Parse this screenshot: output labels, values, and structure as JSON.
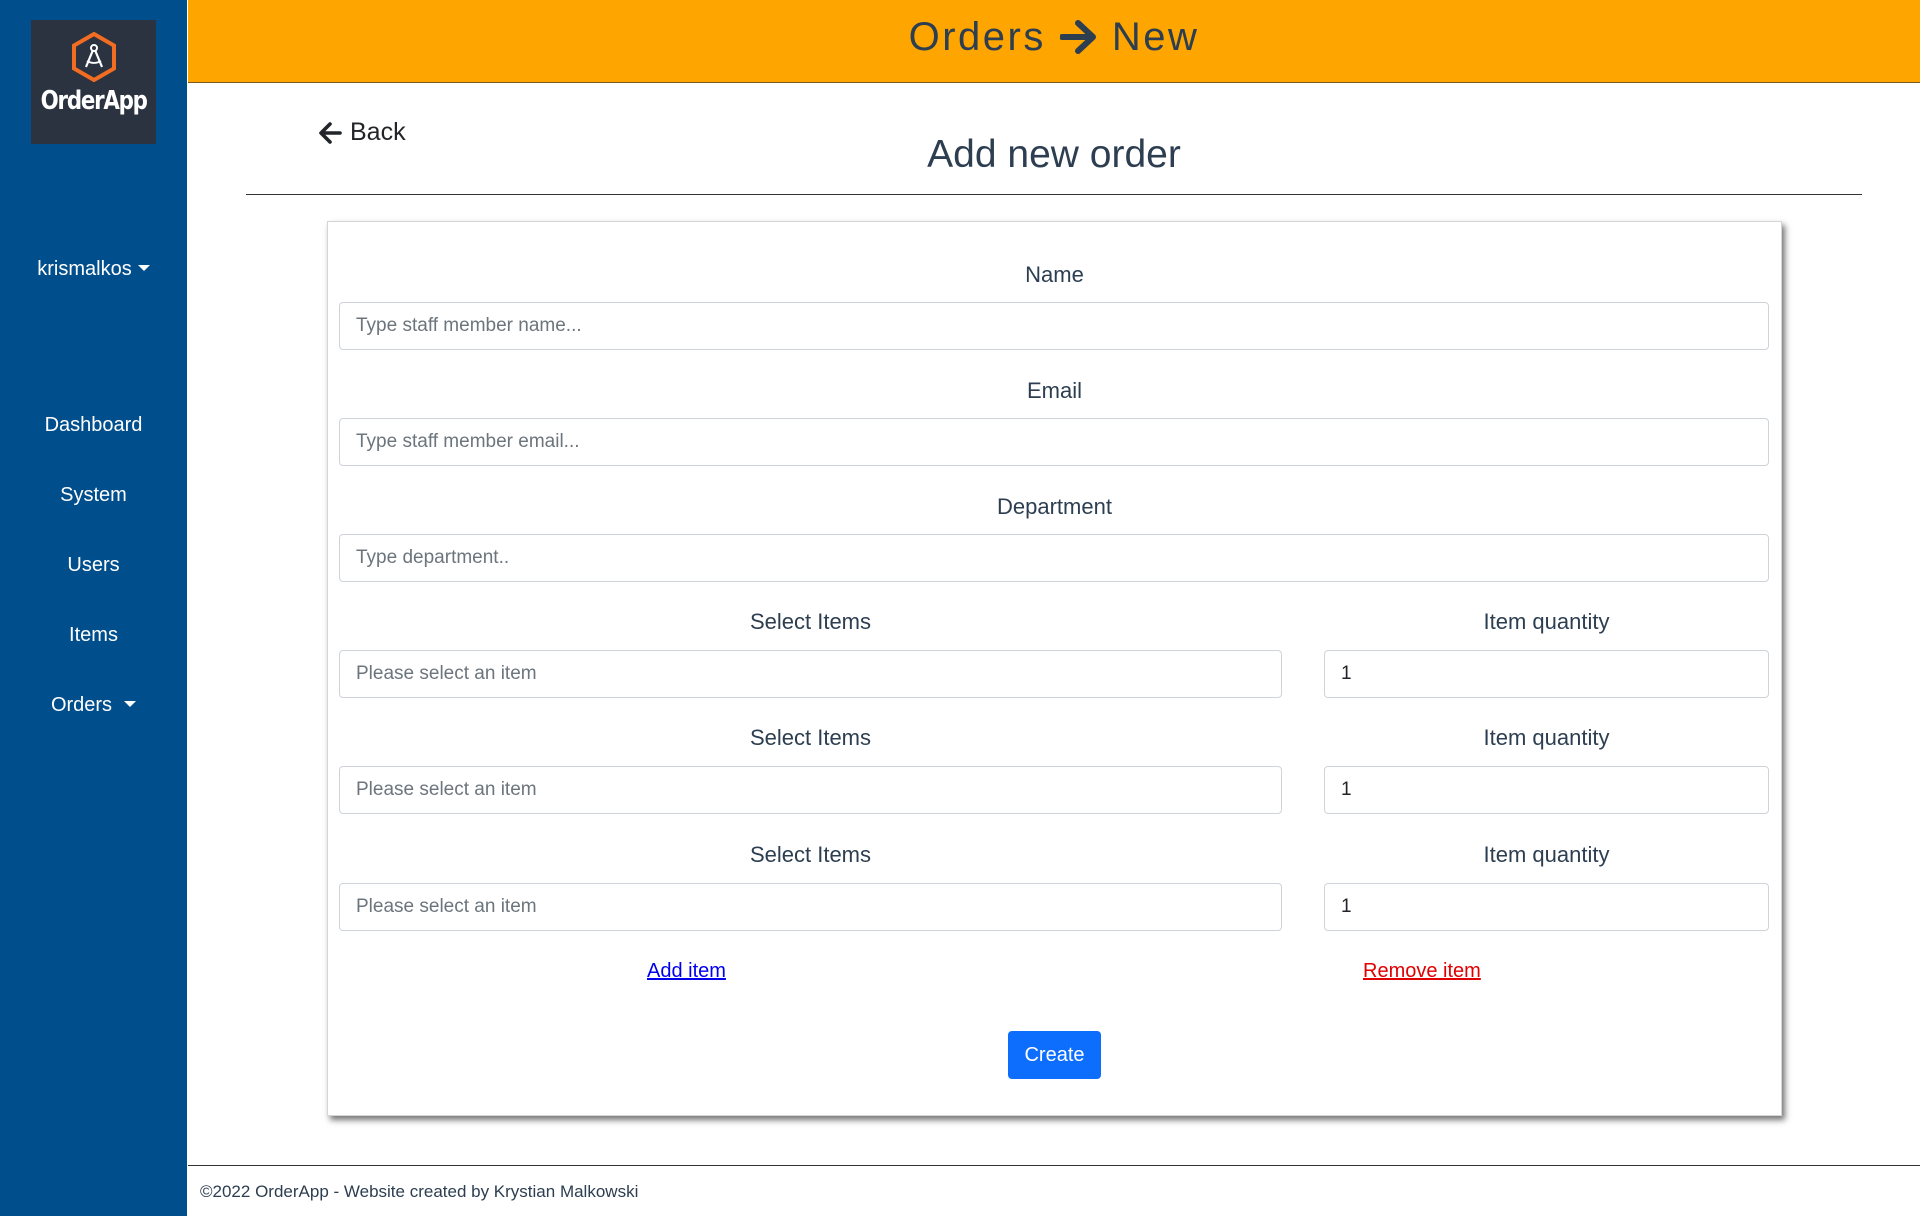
{
  "colors": {
    "sidebar": "#004e8c",
    "header": "#ffa500",
    "logo_bg": "#2b3340",
    "logo_accent": "#f26c22",
    "primary_button": "#0d6efd",
    "add_link": "#0000ee",
    "remove_link": "#e00000"
  },
  "sidebar": {
    "logo_text": "OrderApp",
    "user": "krismalkos",
    "nav": [
      {
        "label": "Dashboard"
      },
      {
        "label": "System"
      },
      {
        "label": "Users"
      },
      {
        "label": "Items"
      },
      {
        "label": "Orders"
      }
    ]
  },
  "header": {
    "section": "Orders",
    "subsection": "New"
  },
  "page": {
    "back_label": "Back",
    "title": "Add new order"
  },
  "form": {
    "name_label": "Name",
    "name_placeholder": "Type staff member name...",
    "email_label": "Email",
    "email_placeholder": "Type staff member email...",
    "department_label": "Department",
    "department_placeholder": "Type department..",
    "item_rows": [
      {
        "select_label": "Select Items",
        "select_placeholder": "Please select an item",
        "quantity_label": "Item quantity",
        "quantity_value": "1"
      },
      {
        "select_label": "Select Items",
        "select_placeholder": "Please select an item",
        "quantity_label": "Item quantity",
        "quantity_value": "1"
      },
      {
        "select_label": "Select Items",
        "select_placeholder": "Please select an item",
        "quantity_label": "Item quantity",
        "quantity_value": "1"
      }
    ],
    "add_item_label": "Add item",
    "remove_item_label": "Remove item",
    "create_label": "Create"
  },
  "footer": {
    "text": "©2022 OrderApp - Website created by Krystian Malkowski"
  }
}
